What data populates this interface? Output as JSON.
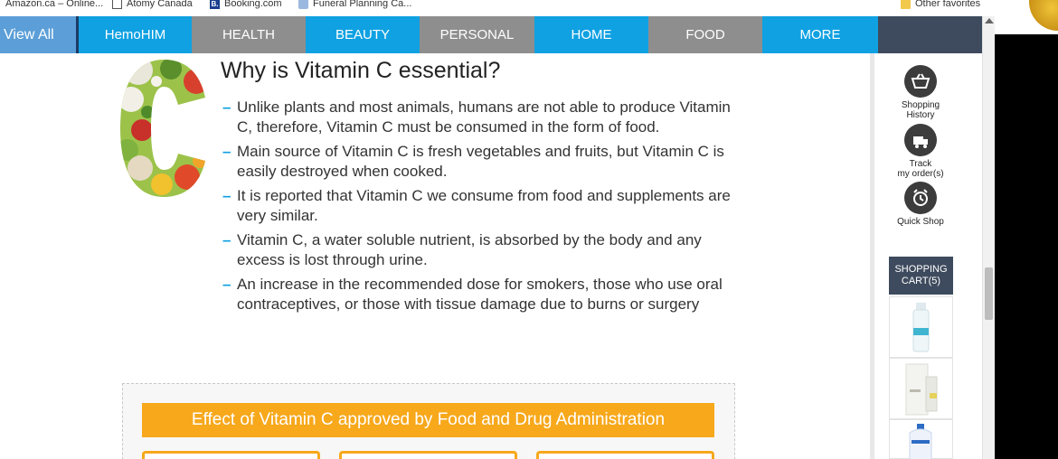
{
  "bookmarks": [
    {
      "label": "Amazon.ca – Online...",
      "icon": "amazon-icon"
    },
    {
      "label": "Atomy Canada",
      "icon": "page-icon"
    },
    {
      "label": "Booking.com",
      "icon": "booking-icon"
    },
    {
      "label": "Funeral Planning Ca...",
      "icon": "funeral-icon"
    },
    {
      "label": "Other favorites",
      "icon": "folder-icon"
    }
  ],
  "nav": {
    "items": [
      {
        "label": "View All"
      },
      {
        "label": "HemoHIM"
      },
      {
        "label": "HEALTH"
      },
      {
        "label": "BEAUTY"
      },
      {
        "label": "PERSONAL"
      },
      {
        "label": "HOME"
      },
      {
        "label": "FOOD"
      },
      {
        "label": "MORE"
      }
    ]
  },
  "content": {
    "heading": "Why is Vitamin C essential?",
    "bullets": [
      "Unlike plants and most animals, humans are not able to produce Vitamin C, therefore, Vitamin C must be consumed in the form of food.",
      "Main source of Vitamin C is fresh vegetables and fruits, but Vitamin C is easily destroyed when cooked.",
      "It is reported that Vitamin C we consume from food and supplements are very similar.",
      "Vitamin C, a water soluble nutrient, is absorbed by the body and any excess is lost through urine.",
      "An increase in the recommended dose for smokers, those who use oral contraceptives, or those with tissue damage due to burns or surgery"
    ],
    "bullet_marker": "–",
    "effect_title": "Effect of Vitamin C approved by Food and Drug Administration"
  },
  "side": {
    "shopping_history": "Shopping\nHistory",
    "track_order": "Track\nmy order(s)",
    "quick_shop": "Quick Shop",
    "cart_label": "SHOPPING\nCART(5)"
  },
  "colors": {
    "nav_blue": "#10a1e2",
    "nav_gray": "#8e8e8e",
    "accent_orange": "#f7a81b",
    "dark_navy": "#3e4b5e"
  }
}
